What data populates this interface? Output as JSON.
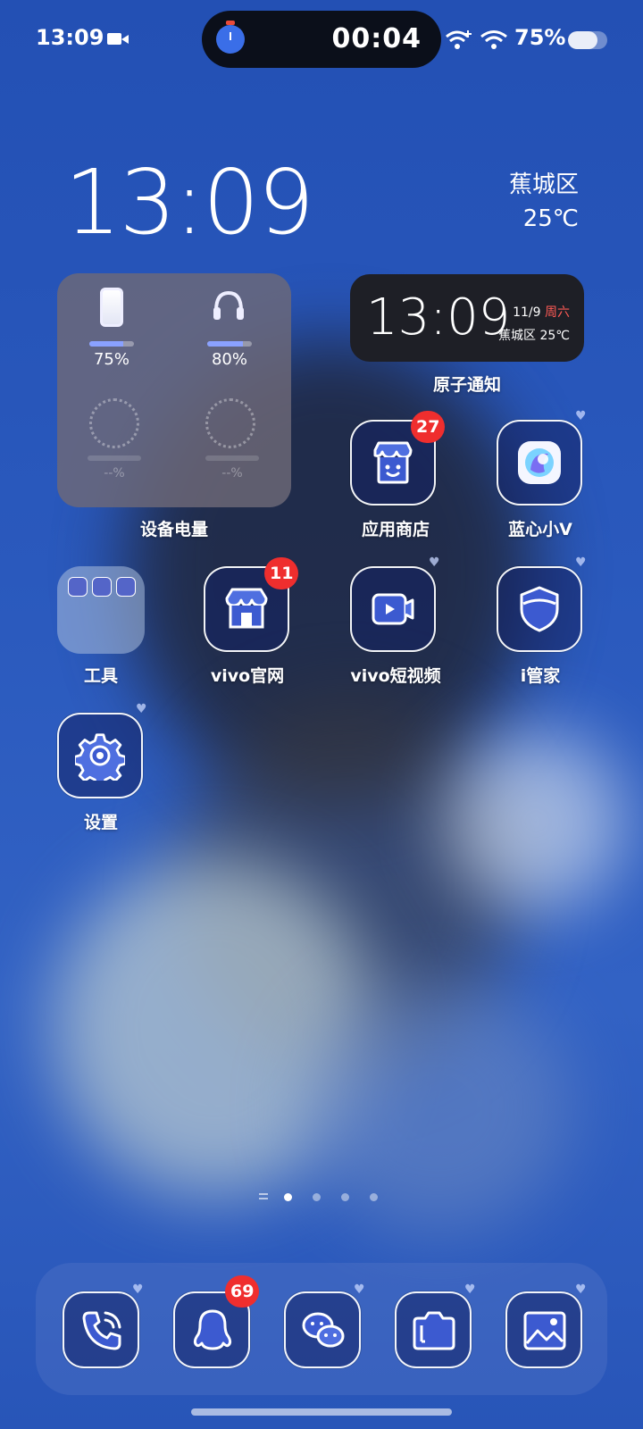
{
  "status_bar": {
    "time": "13:09",
    "timer": "00:04",
    "battery_pct": "75%",
    "battery_level": 0.75
  },
  "clock": {
    "time": "13:09",
    "location": "蕉城区",
    "temperature": "25℃"
  },
  "battery_widget": {
    "label": "设备电量",
    "devices": [
      {
        "icon": "phone-icon",
        "pct": "75%",
        "level": 0.75
      },
      {
        "icon": "headphones-icon",
        "pct": "80%",
        "level": 0.8
      }
    ],
    "empty_slots": [
      {
        "pct": "--%"
      },
      {
        "pct": "--%"
      }
    ]
  },
  "atomic_widget": {
    "label": "原子通知",
    "time": "13:09",
    "date": "11/9",
    "weekday": "周六",
    "location": "蕉城区 25℃"
  },
  "apps": [
    {
      "label": "应用商店",
      "icon": "store-face-icon",
      "badge": "27"
    },
    {
      "label": "蓝心小V",
      "icon": "bluev-icon"
    },
    {
      "label": "工具",
      "icon": "folder-icon"
    },
    {
      "label": "vivo官网",
      "icon": "storefront-icon",
      "badge": "11"
    },
    {
      "label": "vivo短视频",
      "icon": "video-icon"
    },
    {
      "label": "i管家",
      "icon": "shield-icon"
    },
    {
      "label": "设置",
      "icon": "gear-icon"
    }
  ],
  "dock": [
    {
      "icon": "phone-call-icon"
    },
    {
      "icon": "qq-icon",
      "badge": "69"
    },
    {
      "icon": "wechat-icon"
    },
    {
      "icon": "camera-icon"
    },
    {
      "icon": "gallery-icon"
    }
  ],
  "page_indicator": {
    "pages": 4,
    "current": 1
  },
  "colors": {
    "wallpaper": "#2a56b5",
    "badge": "#ef2e2e",
    "accent": "#8aa1ff"
  }
}
